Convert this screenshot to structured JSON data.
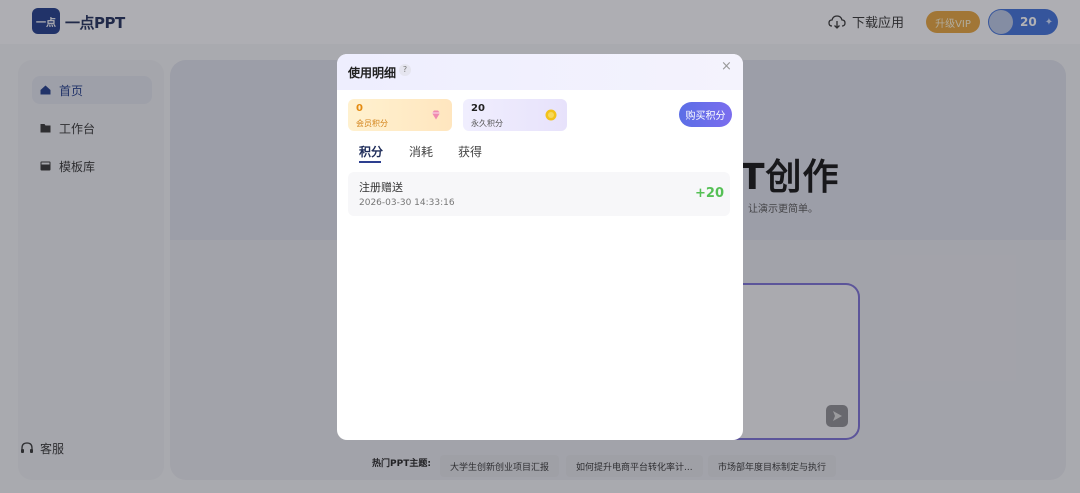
{
  "header": {
    "logo_mark": "一点",
    "logo_text": "一点PPT",
    "download_label": "下载应用",
    "vip_label": "升级VIP",
    "points": "20"
  },
  "sidebar": {
    "items": [
      {
        "label": "首页"
      },
      {
        "label": "工作台"
      },
      {
        "label": "模板库"
      }
    ],
    "service_label": "客服"
  },
  "main": {
    "hero_title_visible": "T创作",
    "hero_subtitle_visible": "让演示更简单。",
    "hot_label": "热门PPT主题:",
    "hot_topics": [
      "大学生创新创业项目汇报",
      "如何提升电商平台转化率计...",
      "市场部年度目标制定与执行"
    ]
  },
  "modal": {
    "title": "使用明细",
    "help": "?",
    "close": "×",
    "member_points": {
      "value": "0",
      "label": "会员积分"
    },
    "forever_points": {
      "value": "20",
      "label": "永久积分"
    },
    "buy_label": "购买积分",
    "tabs": [
      "积分",
      "消耗",
      "获得"
    ],
    "records": [
      {
        "title": "注册赠送",
        "date": "2026-03-30 14:33:16",
        "delta": "+20"
      }
    ]
  },
  "colors": {
    "accent": "#3e6fd9",
    "positive": "#55c055",
    "member_orange": "#e48a10"
  }
}
